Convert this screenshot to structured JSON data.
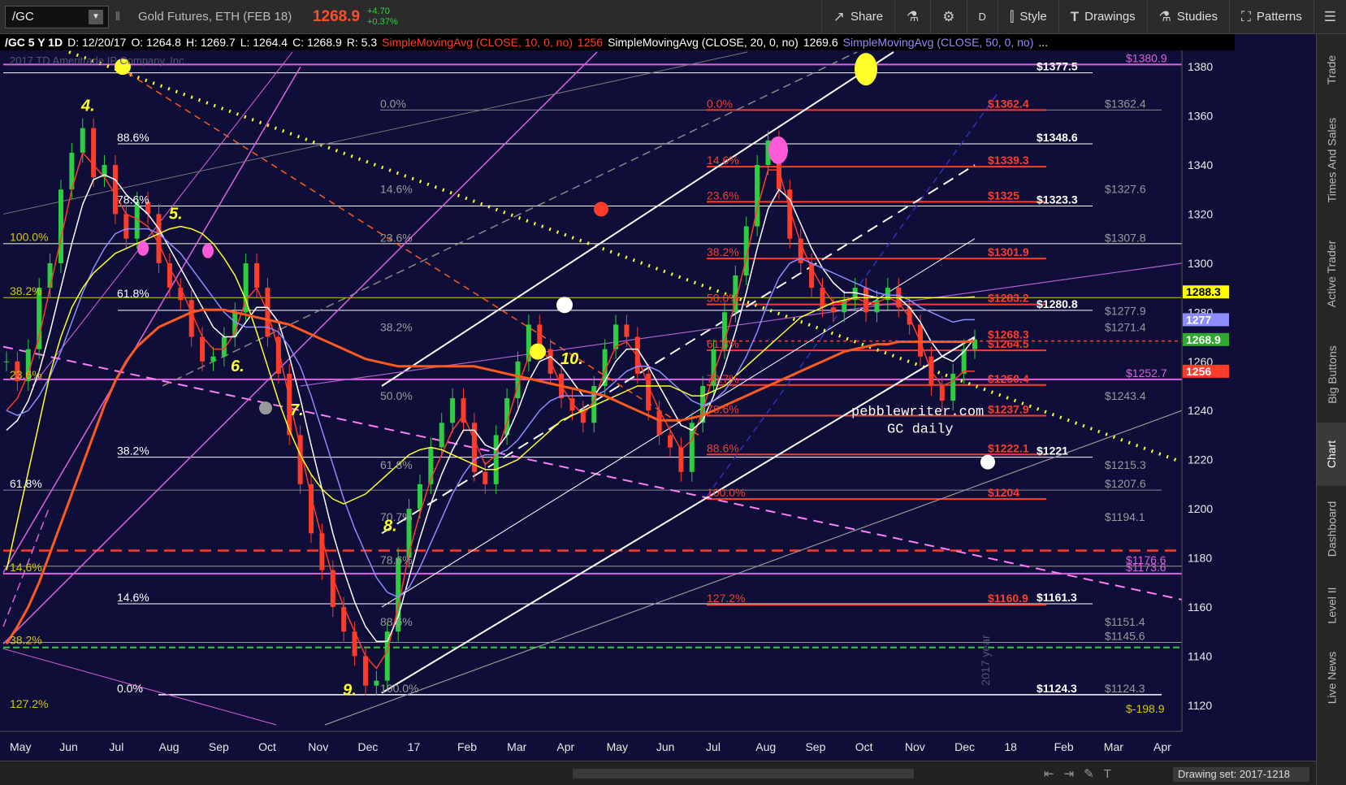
{
  "toolbar": {
    "symbol": "/GC",
    "description": "Gold Futures, ETH (FEB 18)",
    "last": "1268.9",
    "change": "+4.70",
    "change_pct": "+0.37%",
    "buttons": [
      {
        "label": "Share",
        "icon": "share-icon"
      },
      {
        "label": "",
        "icon": "flask-icon"
      },
      {
        "label": "",
        "icon": "gear-icon"
      },
      {
        "label": "D",
        "icon": ""
      },
      {
        "label": "Style",
        "icon": "candle-style-icon"
      },
      {
        "label": "Drawings",
        "icon": "drawings-icon"
      },
      {
        "label": "Studies",
        "icon": "studies-icon"
      },
      {
        "label": "Patterns",
        "icon": "patterns-icon"
      },
      {
        "label": "",
        "icon": "menu-icon"
      }
    ]
  },
  "status": {
    "symbol_period": "/GC 5 Y 1D",
    "date": "D: 12/20/17",
    "open": "O: 1264.8",
    "high": "H: 1269.7",
    "low": "L: 1264.4",
    "close": "C: 1268.9",
    "range": "R: 5.3",
    "sma10": "SimpleMovingAvg (CLOSE, 10, 0, no)",
    "sma10_val": "1256",
    "sma20": "SimpleMovingAvg (CLOSE, 20, 0, no)",
    "sma20_val": "1269.6",
    "sma50": "SimpleMovingAvg (CLOSE, 50, 0, no)",
    "more": "..."
  },
  "watermark": "2017 TD Ameritrade IP Company, Inc.",
  "chart_data": {
    "type": "line",
    "title": "",
    "x_months": [
      "May",
      "Jun",
      "Jul",
      "Aug",
      "Sep",
      "Oct",
      "Nov",
      "Dec",
      "17",
      "Feb",
      "Mar",
      "Apr",
      "May",
      "Jun",
      "Jul",
      "Aug",
      "Sep",
      "Oct",
      "Nov",
      "Dec",
      "18",
      "Feb",
      "Mar",
      "Apr"
    ],
    "y_ticks": [
      1120,
      1140,
      1160,
      1180,
      1200,
      1220,
      1240,
      1260,
      1280,
      1300,
      1320,
      1340,
      1360,
      1380
    ],
    "ylim": [
      1112,
      1386
    ],
    "series": [
      {
        "name": "",
        "color": "#4fd34f",
        "values": [
          1260,
          1252,
          1265,
          1290,
          1300,
          1330,
          1345,
          1355,
          1335,
          1340,
          1320,
          1310,
          1325,
          1320,
          1300,
          1290,
          1285,
          1270,
          1260,
          1262,
          1270,
          1280,
          1300,
          1290,
          1270,
          1255,
          1230,
          1210,
          1190,
          1175,
          1160,
          1150,
          1140,
          1128,
          1130,
          1150,
          1180,
          1200,
          1210,
          1225,
          1235,
          1245,
          1235,
          1215,
          1210,
          1230,
          1245,
          1260,
          1275,
          1265,
          1255,
          1245,
          1240,
          1235,
          1250,
          1265,
          1275,
          1270,
          1255,
          1240,
          1230,
          1225,
          1215,
          1235,
          1250,
          1265,
          1280,
          1295,
          1315,
          1340,
          1350,
          1330,
          1310,
          1300,
          1290,
          1282,
          1280,
          1285,
          1290,
          1280,
          1285,
          1290,
          1282,
          1275,
          1262,
          1250,
          1244,
          1255,
          1265,
          1269
        ]
      },
      {
        "name": "SMA 10",
        "color": "#ff3b2a",
        "values": [
          1240,
          1245,
          1255,
          1270,
          1290,
          1310,
          1330,
          1345,
          1340,
          1335,
          1328,
          1320,
          1318,
          1315,
          1308,
          1298,
          1290,
          1280,
          1270,
          1265,
          1265,
          1272,
          1285,
          1290,
          1280,
          1265,
          1245,
          1225,
          1205,
          1188,
          1172,
          1160,
          1150,
          1140,
          1135,
          1142,
          1160,
          1182,
          1198,
          1212,
          1222,
          1232,
          1238,
          1228,
          1218,
          1222,
          1235,
          1250,
          1262,
          1266,
          1260,
          1250,
          1243,
          1238,
          1244,
          1256,
          1266,
          1268,
          1262,
          1250,
          1240,
          1232,
          1224,
          1228,
          1240,
          1255,
          1268,
          1284,
          1302,
          1322,
          1338,
          1338,
          1322,
          1308,
          1298,
          1290,
          1284,
          1284,
          1286,
          1284,
          1284,
          1286,
          1284,
          1278,
          1268,
          1256,
          1250,
          1252,
          1256,
          1256
        ]
      },
      {
        "name": "SMA 20",
        "color": "#ffffff",
        "values": [
          1232,
          1236,
          1244,
          1256,
          1272,
          1290,
          1308,
          1324,
          1334,
          1336,
          1334,
          1328,
          1324,
          1320,
          1314,
          1306,
          1298,
          1290,
          1282,
          1274,
          1270,
          1270,
          1276,
          1282,
          1282,
          1276,
          1262,
          1245,
          1226,
          1208,
          1190,
          1175,
          1162,
          1152,
          1146,
          1146,
          1156,
          1172,
          1188,
          1202,
          1214,
          1224,
          1232,
          1232,
          1226,
          1224,
          1230,
          1240,
          1252,
          1260,
          1262,
          1258,
          1252,
          1246,
          1246,
          1252,
          1260,
          1265,
          1265,
          1258,
          1250,
          1242,
          1234,
          1232,
          1236,
          1246,
          1258,
          1272,
          1288,
          1306,
          1322,
          1330,
          1326,
          1316,
          1306,
          1298,
          1292,
          1288,
          1288,
          1287,
          1286,
          1286,
          1286,
          1282,
          1276,
          1268,
          1262,
          1260,
          1264,
          1269.6
        ]
      },
      {
        "name": "SMA 50",
        "color": "#8c8cff",
        "values": [
          1240,
          1238,
          1240,
          1246,
          1254,
          1264,
          1276,
          1288,
          1298,
          1306,
          1312,
          1314,
          1314,
          1314,
          1312,
          1308,
          1304,
          1298,
          1292,
          1286,
          1280,
          1276,
          1274,
          1274,
          1274,
          1272,
          1266,
          1258,
          1246,
          1232,
          1218,
          1204,
          1192,
          1182,
          1172,
          1166,
          1164,
          1168,
          1176,
          1186,
          1196,
          1206,
          1214,
          1220,
          1222,
          1222,
          1224,
          1228,
          1234,
          1240,
          1244,
          1246,
          1246,
          1246,
          1246,
          1248,
          1252,
          1256,
          1258,
          1258,
          1256,
          1252,
          1248,
          1244,
          1242,
          1244,
          1248,
          1254,
          1262,
          1272,
          1284,
          1294,
          1300,
          1302,
          1300,
          1298,
          1296,
          1294,
          1292,
          1290,
          1288,
          1287,
          1287,
          1285,
          1282,
          1280,
          1278,
          1276,
          1277,
          1277
        ]
      },
      {
        "name": "",
        "color": "#ffff2a",
        "values": [
          1175,
          1195,
          1215,
          1235,
          1255,
          1270,
          1282,
          1290,
          1296,
          1300,
          1304,
          1306,
          1308,
          1310,
          1312,
          1314,
          1315,
          1314,
          1312,
          1308,
          1302,
          1295,
          1285,
          1272,
          1258,
          1244,
          1232,
          1222,
          1214,
          1208,
          1204,
          1202,
          1204,
          1206,
          1210,
          1214,
          1218,
          1222,
          1224,
          1225,
          1224,
          1222,
          1220,
          1218,
          1216,
          1216,
          1218,
          1220,
          1224,
          1228,
          1232,
          1236,
          1238,
          1240,
          1242,
          1244,
          1246,
          1248,
          1250,
          1250,
          1250,
          1250,
          1248,
          1246,
          1246,
          1248,
          1250,
          1254,
          1258,
          1262,
          1266,
          1270,
          1274,
          1278,
          1280,
          1282,
          1284,
          1285,
          1286,
          1286,
          1286,
          1286,
          1286,
          1286,
          1286,
          1286,
          1286,
          1286,
          1286,
          1286.3
        ]
      },
      {
        "name": "",
        "color": "#ff5a1e",
        "values": [
          1145,
          1152,
          1160,
          1170,
          1182,
          1194,
          1206,
          1218,
          1230,
          1242,
          1252,
          1260,
          1266,
          1270,
          1274,
          1276,
          1278,
          1280,
          1281,
          1281,
          1281,
          1280,
          1279,
          1278,
          1277,
          1276,
          1275,
          1273,
          1271,
          1269,
          1267,
          1265,
          1263,
          1261,
          1260,
          1259,
          1258,
          1258,
          1258,
          1258,
          1258,
          1258,
          1258,
          1258,
          1257,
          1256,
          1255,
          1254,
          1253,
          1252,
          1251,
          1250,
          1249,
          1248,
          1247,
          1246,
          1244,
          1242,
          1240,
          1238,
          1236,
          1236,
          1236,
          1237,
          1238,
          1240,
          1242,
          1244,
          1246,
          1248,
          1250,
          1252,
          1254,
          1256,
          1258,
          1260,
          1262,
          1264,
          1265,
          1266,
          1267,
          1267,
          1268,
          1268,
          1268,
          1268,
          1268,
          1268,
          1268,
          1268.3
        ]
      }
    ],
    "price_labels_right": [
      {
        "text": "1377.5",
        "y": 1377.5,
        "color": "#ffffff"
      },
      {
        "text": "1348.6",
        "y": 1348.6,
        "color": "#ffffff"
      },
      {
        "text": "1323.3",
        "y": 1323.3,
        "color": "#ffffff"
      },
      {
        "text": "1280.8",
        "y": 1280.8,
        "color": "#ffffff"
      },
      {
        "text": "1221",
        "y": 1221,
        "color": "#ffffff"
      },
      {
        "text": "1161.3",
        "y": 1161.3,
        "color": "#ffffff"
      },
      {
        "text": "1124.3",
        "y": 1124.3,
        "color": "#ffffff"
      },
      {
        "text": "1362.4",
        "y": 1362.4,
        "color": "#ff3b2a"
      },
      {
        "text": "1339.3",
        "y": 1339.3,
        "color": "#ff3b2a"
      },
      {
        "text": "1325",
        "y": 1325,
        "color": "#ff3b2a"
      },
      {
        "text": "1301.9",
        "y": 1301.9,
        "color": "#ff3b2a"
      },
      {
        "text": "1283.2",
        "y": 1283.2,
        "color": "#ff3b2a"
      },
      {
        "text": "1268.3",
        "y": 1268.3,
        "color": "#ff3b2a"
      },
      {
        "text": "1264.5",
        "y": 1264.5,
        "color": "#ff3b2a"
      },
      {
        "text": "1250.4",
        "y": 1250.4,
        "color": "#ff3b2a"
      },
      {
        "text": "1237.9",
        "y": 1237.9,
        "color": "#ff3b2a"
      },
      {
        "text": "1222.1",
        "y": 1222.1,
        "color": "#ff3b2a"
      },
      {
        "text": "1204",
        "y": 1204,
        "color": "#ff3b2a"
      },
      {
        "text": "1160.9",
        "y": 1160.9,
        "color": "#ff3b2a"
      }
    ],
    "grey_labels": [
      {
        "text": "1362.4",
        "y": 1362.4
      },
      {
        "text": "1327.6",
        "y": 1327.6
      },
      {
        "text": "1307.8",
        "y": 1307.8
      },
      {
        "text": "1277.9",
        "y": 1277.9
      },
      {
        "text": "1271.4",
        "y": 1271.4
      },
      {
        "text": "1243.4",
        "y": 1243.4
      },
      {
        "text": "1215.3",
        "y": 1215.3
      },
      {
        "text": "1207.6",
        "y": 1207.6
      },
      {
        "text": "1194.1",
        "y": 1194.1
      },
      {
        "text": "1151.4",
        "y": 1151.4
      },
      {
        "text": "1145.6",
        "y": 1145.6
      },
      {
        "text": "1124.3",
        "y": 1124.3
      }
    ],
    "magenta_labels": [
      {
        "text": "1380.9",
        "y": 1380.9
      },
      {
        "text": "1252.7",
        "y": 1252.7
      },
      {
        "text": "1176.6",
        "y": 1176.6
      },
      {
        "text": "1173.6",
        "y": 1173.6
      }
    ],
    "axis_badges": [
      {
        "text": "1288.3",
        "y": 1288.3,
        "bg": "#ffff00",
        "fg": "#000000"
      },
      {
        "text": "1277",
        "y": 1277,
        "bg": "#8c8cff",
        "fg": "#ffffff"
      },
      {
        "text": "1268.9",
        "y": 1268.9,
        "bg": "#2ea82e",
        "fg": "#ffffff"
      },
      {
        "text": "1256",
        "y": 1256,
        "bg": "#ff3b2a",
        "fg": "#ffffff"
      }
    ],
    "fib_left": [
      {
        "text": "88.6%",
        "y": 1348.6
      },
      {
        "text": "78.6%",
        "y": 1323.3
      },
      {
        "text": "100.0%",
        "y": 1308
      },
      {
        "text": "61.8%",
        "y": 1285
      },
      {
        "text": "38.2%",
        "y": 1221
      },
      {
        "text": "61.8%",
        "y": 1207.6
      },
      {
        "text": "14.6%",
        "y": 1161.3
      },
      {
        "text": "0.0%",
        "y": 1124.3
      },
      {
        "text": "127.2%",
        "y": 1118
      }
    ],
    "fib_mid": [
      {
        "text": "0.0%",
        "y": 1362.4
      },
      {
        "text": "14.6%",
        "y": 1327.6
      },
      {
        "text": "23.6%",
        "y": 1307.8
      },
      {
        "text": "38.2%",
        "y": 1271.4
      },
      {
        "text": "50.0%",
        "y": 1243.4
      },
      {
        "text": "61.8%",
        "y": 1215.3
      },
      {
        "text": "70.7%",
        "y": 1194.1
      },
      {
        "text": "78.6%",
        "y": 1176.6
      },
      {
        "text": "88.6%",
        "y": 1151.4
      },
      {
        "text": "100.0%",
        "y": 1124.3
      }
    ],
    "fib_red": [
      {
        "text": "0.0%",
        "y": 1362.4
      },
      {
        "text": "14.6%",
        "y": 1339.3
      },
      {
        "text": "23.6%",
        "y": 1325
      },
      {
        "text": "38.2%",
        "y": 1301.9
      },
      {
        "text": "50.0%",
        "y": 1283.2
      },
      {
        "text": "61.8%",
        "y": 1264.5
      },
      {
        "text": "70.7%",
        "y": 1250.4
      },
      {
        "text": "78.6%",
        "y": 1237.9
      },
      {
        "text": "88.6%",
        "y": 1222.1
      },
      {
        "text": "100.0%",
        "y": 1204
      },
      {
        "text": "127.2%",
        "y": 1160.9
      }
    ],
    "fib_left_extra": [
      {
        "text": "38.2%",
        "y": 1286
      },
      {
        "text": "23.6%",
        "y": 1252
      },
      {
        "text": "14.6%",
        "y": 1173.6
      },
      {
        "text": "38.2%",
        "y": 1144
      }
    ],
    "wave_labels": [
      "4.",
      "5.",
      "6.",
      "7.",
      "8.",
      "9.",
      "10."
    ],
    "annotation": {
      "line1": "pebblewriter.com",
      "line2": "GC daily"
    },
    "year_label": "2017 year"
  },
  "right_tabs": [
    "Trade",
    "Times And Sales",
    "Active Trader",
    "Big Buttons",
    "Chart",
    "Dashboard",
    "Level II",
    "Live News"
  ],
  "bottom": {
    "drawing_set": "Drawing set: 2017-1218"
  }
}
